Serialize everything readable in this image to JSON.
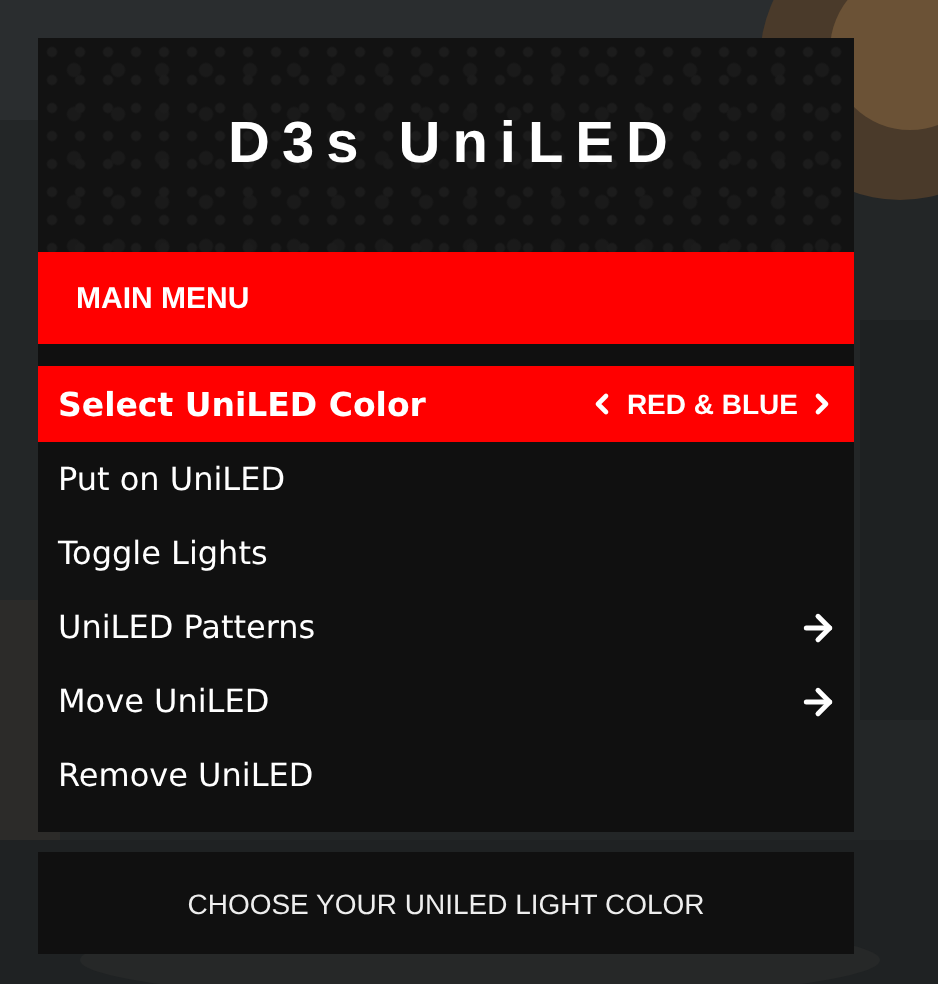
{
  "menu": {
    "title": "D3s UniLED",
    "subtitle": "MAIN MENU",
    "items": [
      {
        "label": "Select UniLED Color",
        "kind": "option",
        "value": "RED & BLUE",
        "selected": true
      },
      {
        "label": "Put on UniLED",
        "kind": "action",
        "selected": false
      },
      {
        "label": "Toggle Lights",
        "kind": "action",
        "selected": false
      },
      {
        "label": "UniLED Patterns",
        "kind": "submenu",
        "selected": false
      },
      {
        "label": "Move UniLED",
        "kind": "submenu",
        "selected": false
      },
      {
        "label": "Remove UniLED",
        "kind": "action",
        "selected": false
      }
    ],
    "description": "CHOOSE YOUR UNILED LIGHT COLOR"
  }
}
